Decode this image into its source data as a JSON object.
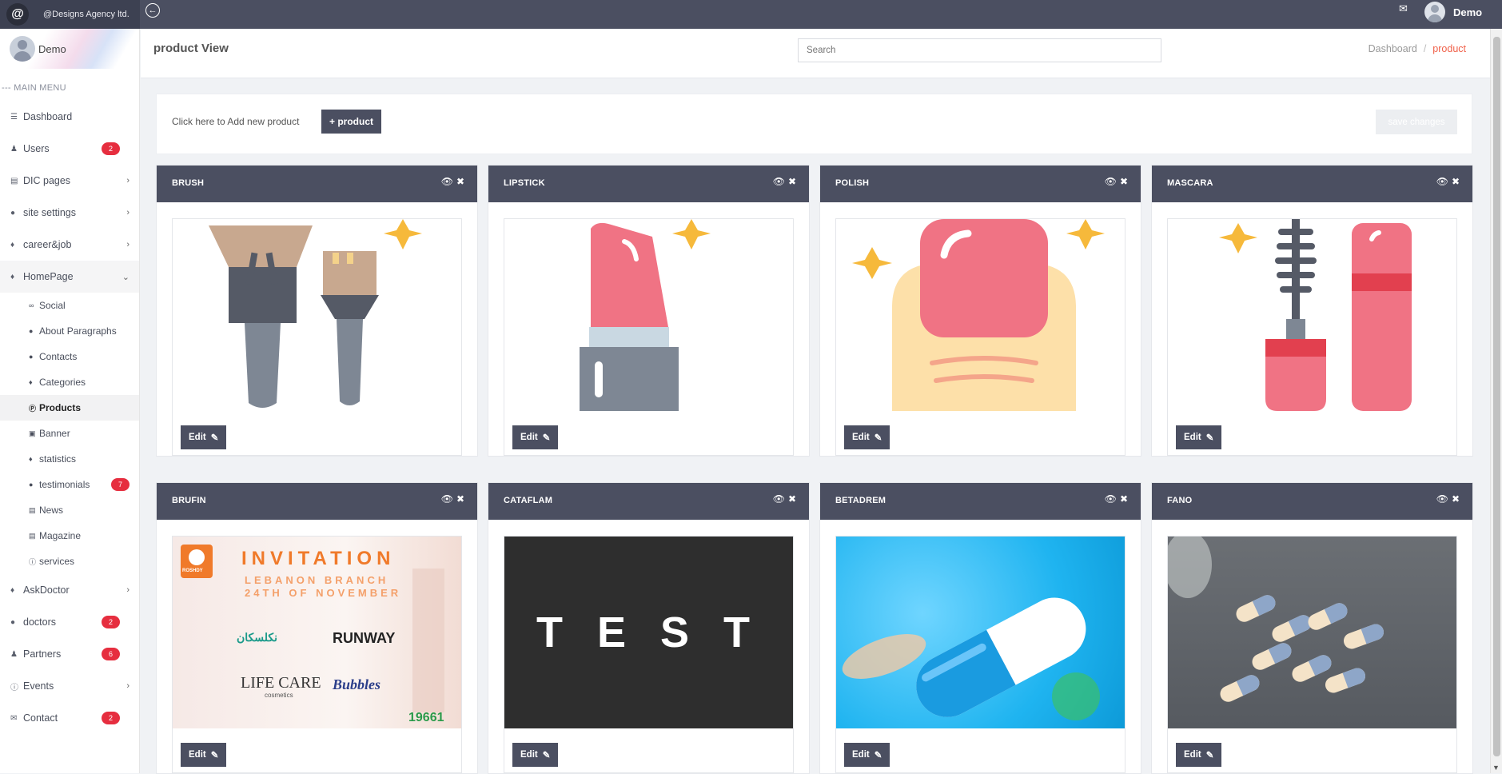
{
  "topbar": {
    "brand_logo": "@",
    "brand_name": "@Designs Agency ltd.",
    "user_name": "Demo",
    "icons": {
      "back": "back-circle-icon",
      "mail": "mail-icon"
    }
  },
  "sidebar": {
    "profile_name": "Demo",
    "menu_heading": "--- MAIN MENU",
    "items": [
      {
        "label": "Dashboard",
        "icon": "bars-icon"
      },
      {
        "label": "Users",
        "icon": "users-icon",
        "badge": "2"
      },
      {
        "label": "DIC pages",
        "icon": "page-icon"
      },
      {
        "label": "site settings",
        "icon": "circle-icon"
      },
      {
        "label": "career&job",
        "icon": "tag-icon"
      },
      {
        "label": "HomePage",
        "icon": "tag-icon"
      },
      {
        "label": "AskDoctor",
        "icon": "tag-icon"
      },
      {
        "label": "doctors",
        "icon": "circle-icon",
        "badge": "2"
      },
      {
        "label": "Partners",
        "icon": "users-icon",
        "badge": "6"
      },
      {
        "label": "Events",
        "icon": "info-icon"
      },
      {
        "label": "Contact",
        "icon": "mail-icon",
        "badge": "2"
      }
    ],
    "homepage_sub": [
      {
        "label": "Social",
        "icon": "link-icon"
      },
      {
        "label": "About Paragraphs",
        "icon": "circle-icon"
      },
      {
        "label": "Contacts",
        "icon": "circle-icon"
      },
      {
        "label": "Categories",
        "icon": "tag-icon"
      },
      {
        "label": "Products",
        "icon": "product-icon"
      },
      {
        "label": "Banner",
        "icon": "image-icon"
      },
      {
        "label": "statistics",
        "icon": "tag-icon"
      },
      {
        "label": "testimonials",
        "icon": "circle-icon",
        "badge": "7"
      },
      {
        "label": "News",
        "icon": "page-icon"
      },
      {
        "label": "Magazine",
        "icon": "page-icon"
      },
      {
        "label": "services",
        "icon": "info-icon"
      }
    ]
  },
  "header": {
    "title": "product View",
    "search_placeholder": "Search",
    "breadcrumb": [
      "Dashboard",
      "product"
    ]
  },
  "add_panel": {
    "text": "Click here to Add new product",
    "add_button": "+ product",
    "save_button": "save changes"
  },
  "products": [
    {
      "name": "BRUSH",
      "image": "brush-illustration"
    },
    {
      "name": "LIPSTICK",
      "image": "lipstick-illustration"
    },
    {
      "name": "POLISH",
      "image": "nail-polish-illustration"
    },
    {
      "name": "MASCARA",
      "image": "mascara-illustration"
    },
    {
      "name": "BRUFIN",
      "image": "invitation-poster"
    },
    {
      "name": "CATAFLAM",
      "image": "test-banner"
    },
    {
      "name": "BETADREM",
      "image": "blue-capsule-photo"
    },
    {
      "name": "FANO",
      "image": "capsules-spilled-photo"
    }
  ],
  "edit_label": "Edit",
  "poster": {
    "title": "INVITATION",
    "line1": "LEBANON BRANCH",
    "line2": "24TH OF NOVEMBER",
    "brand_left": "ROSHDY",
    "logo1": "RUNWAY",
    "logo2": "LIFE CARE",
    "logo2_sub": "cosmetics",
    "logo3": "Bubbles",
    "logo4": "نكلسكان",
    "hotline": "19661"
  },
  "test_banner": "T E S T",
  "colors": {
    "header": "#4b4f61",
    "badge": "#e62e3f",
    "accent": "#f0614a"
  }
}
